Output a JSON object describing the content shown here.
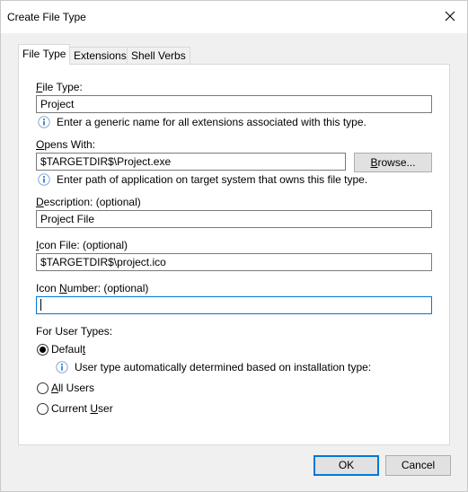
{
  "window": {
    "title": "Create File Type"
  },
  "tabs": [
    {
      "label": "File Type",
      "active": true
    },
    {
      "label": "Extensions",
      "active": false
    },
    {
      "label": "Shell Verbs",
      "active": false
    }
  ],
  "file_type": {
    "label_key": "F",
    "label_rest": "ile Type:",
    "value": "Project",
    "hint": "Enter a generic name for all extensions associated with this type."
  },
  "opens_with": {
    "label_key": "O",
    "label_rest": "pens With:",
    "value": "$TARGETDIR$\\Project.exe",
    "hint": "Enter path of application on target system that owns this file type.",
    "browse_key": "B",
    "browse_rest": "rowse..."
  },
  "description": {
    "label_key": "D",
    "label_rest": "escription: (optional)",
    "value": "Project File"
  },
  "icon_file": {
    "label_key": "I",
    "label_rest": "con File: (optional)",
    "value": "$TARGETDIR$\\project.ico"
  },
  "icon_number": {
    "label_pre": "Icon ",
    "label_key": "N",
    "label_rest": "umber: (optional)",
    "value": ""
  },
  "user_types": {
    "label": "For User Types:",
    "options": [
      {
        "key": "",
        "pre": "Defaul",
        "post_key": "t",
        "selected": true
      },
      {
        "key": "A",
        "rest": "ll Users",
        "selected": false
      },
      {
        "pre": "Current ",
        "key": "U",
        "rest": "ser",
        "selected": false
      }
    ],
    "default_hint": "User type automatically determined based on installation type:"
  },
  "buttons": {
    "ok": "OK",
    "cancel": "Cancel"
  },
  "colors": {
    "accent": "#0078d7",
    "dialog_bg": "#f0f0f0",
    "info_blue": "#1e6fc7"
  },
  "icons": {
    "close": "close-icon",
    "info": "info-icon"
  }
}
